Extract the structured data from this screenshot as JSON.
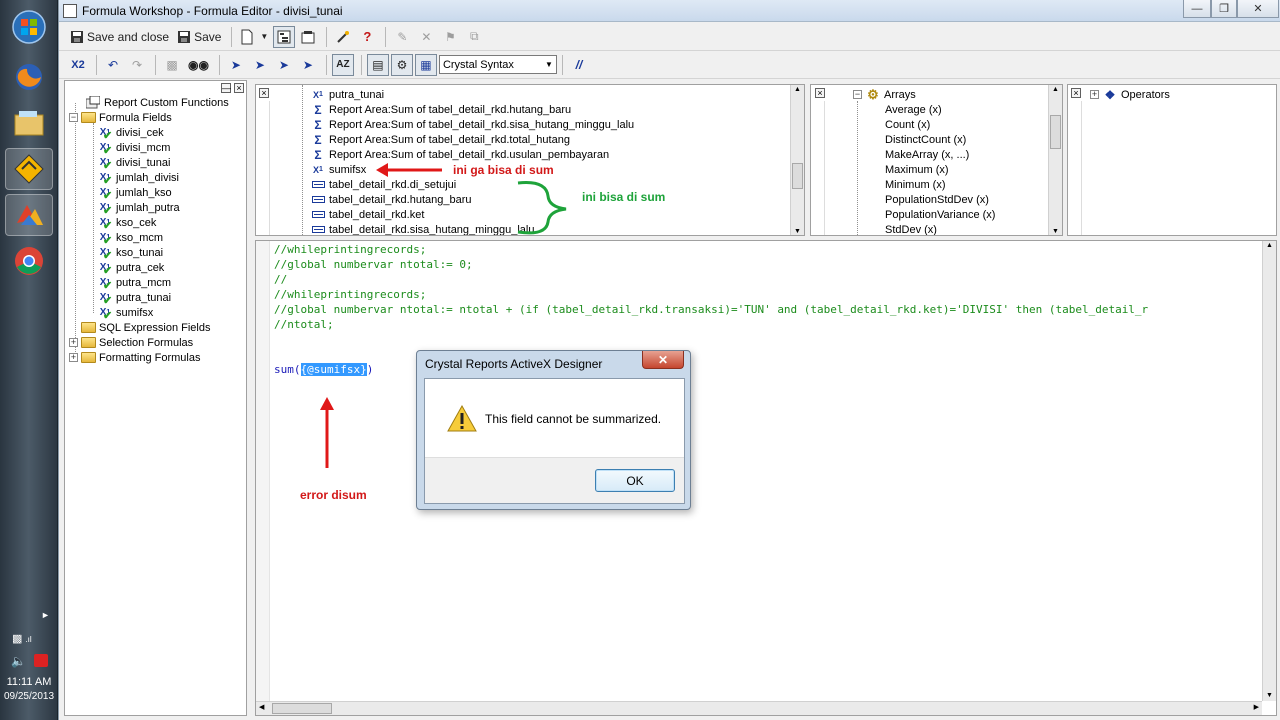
{
  "taskbar": {
    "time": "11:11 AM",
    "date": "09/25/2013"
  },
  "window": {
    "title": "Formula Workshop - Formula Editor - divisi_tunai"
  },
  "toolbar1": {
    "save_close_label": "Save and close",
    "save_label": "Save"
  },
  "toolbar2": {
    "syntax_selected": "Crystal Syntax",
    "x2_label": "X2",
    "comment_label": "//"
  },
  "left_tree": {
    "report_custom_functions": "Report Custom Functions",
    "formula_fields": "Formula Fields",
    "formulas": [
      "divisi_cek",
      "divisi_mcm",
      "divisi_tunai",
      "jumlah_divisi",
      "jumlah_kso",
      "jumlah_putra",
      "kso_cek",
      "kso_mcm",
      "kso_tunai",
      "putra_cek",
      "putra_mcm",
      "putra_tunai",
      "sumifsx"
    ],
    "sql_expression_fields": "SQL Expression Fields",
    "selection_formulas": "Selection Formulas",
    "formatting_formulas": "Formatting Formulas"
  },
  "fields_pane": {
    "items": [
      {
        "icon": "formula",
        "label": "putra_tunai"
      },
      {
        "icon": "sum",
        "label": "Report Area:Sum of tabel_detail_rkd.hutang_baru"
      },
      {
        "icon": "sum",
        "label": "Report Area:Sum of tabel_detail_rkd.sisa_hutang_minggu_lalu"
      },
      {
        "icon": "sum",
        "label": "Report Area:Sum of tabel_detail_rkd.total_hutang"
      },
      {
        "icon": "sum",
        "label": "Report Area:Sum of tabel_detail_rkd.usulan_pembayaran"
      },
      {
        "icon": "formula",
        "label": "sumifsx"
      },
      {
        "icon": "field",
        "label": "tabel_detail_rkd.di_setujui"
      },
      {
        "icon": "field",
        "label": "tabel_detail_rkd.hutang_baru"
      },
      {
        "icon": "field",
        "label": "tabel_detail_rkd.ket"
      },
      {
        "icon": "field",
        "label": "tabel_detail_rkd.sisa_hutang_minggu_lalu"
      }
    ]
  },
  "functions_pane": {
    "group": "Arrays",
    "items": [
      "Average (x)",
      "Count (x)",
      "DistinctCount (x)",
      "MakeArray (x, ...)",
      "Maximum (x)",
      "Minimum (x)",
      "PopulationStdDev (x)",
      "PopulationVariance (x)",
      "StdDev (x)"
    ]
  },
  "operators_pane": {
    "group": "Operators"
  },
  "editor": {
    "lines": [
      "//whileprintingrecords;",
      "//global numbervar ntotal:= 0;",
      "//",
      "//whileprintingrecords;",
      "//global numbervar ntotal:= ntotal + (if (tabel_detail_rkd.transaksi)='TUN' and (tabel_detail_rkd.ket)='DIVISI' then (tabel_detail_r",
      "//ntotal;"
    ],
    "sum_prefix": "sum(",
    "sum_selected": "{@sumifsx}",
    "sum_suffix": ")"
  },
  "annotations": {
    "cannot_sum": "ini ga bisa di sum",
    "can_sum": "ini bisa di sum",
    "error": "error disum"
  },
  "dialog": {
    "title": "Crystal Reports ActiveX Designer",
    "message": "This field cannot be summarized.",
    "ok_label": "OK"
  }
}
